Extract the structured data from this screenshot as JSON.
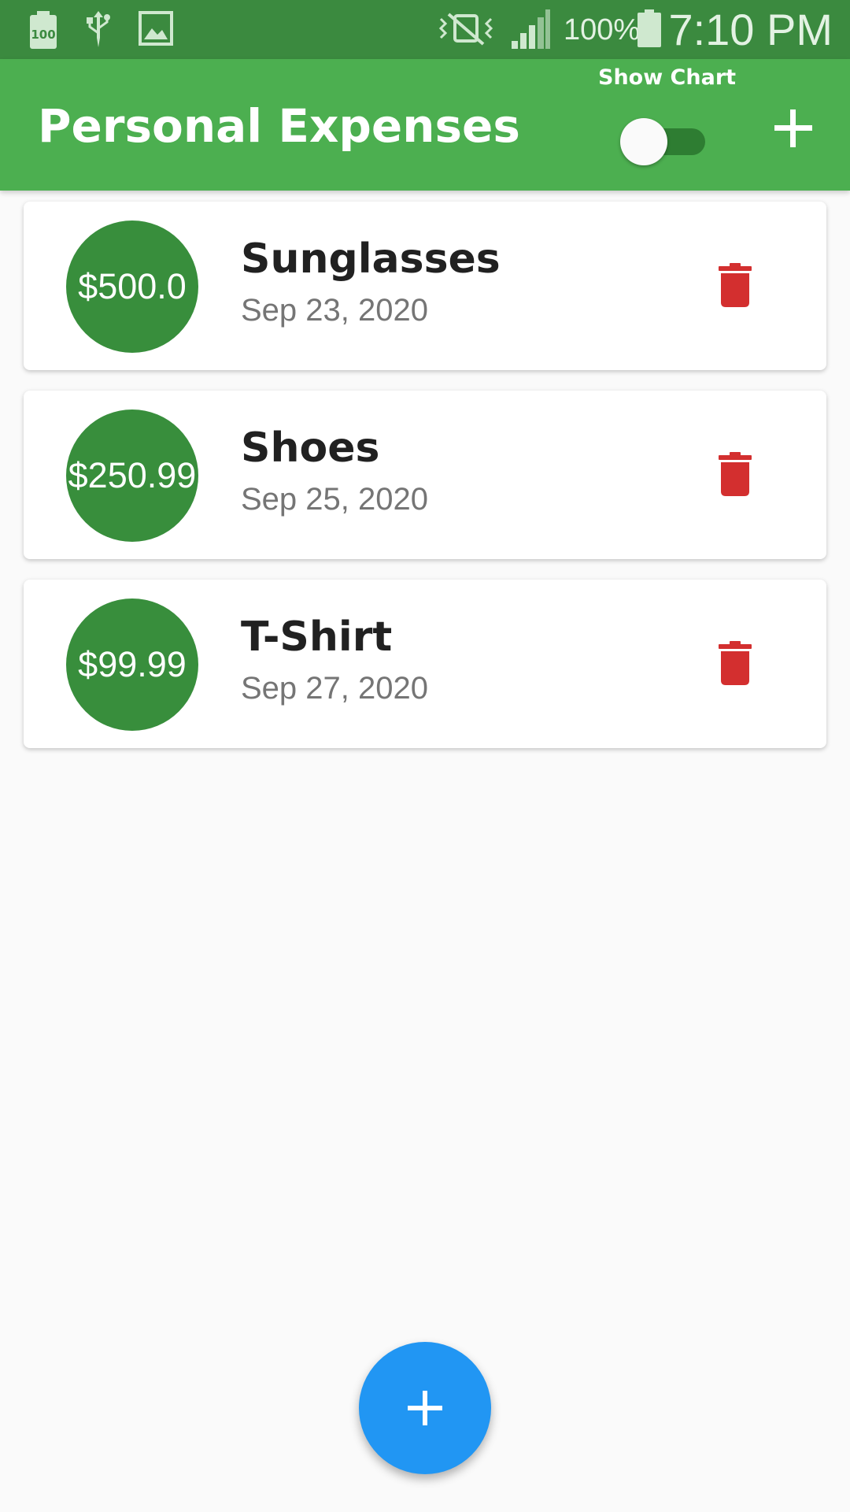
{
  "status_bar": {
    "battery_percent": "100%",
    "time": "7:10 PM",
    "icons": [
      "battery-saver-icon",
      "usb-icon",
      "image-icon",
      "vibrate-icon",
      "signal-icon",
      "battery-icon"
    ]
  },
  "app_bar": {
    "title": "Personal Expenses",
    "chart_toggle_label": "Show Chart",
    "chart_toggle_on": false,
    "add_icon": "plus-icon"
  },
  "transactions": [
    {
      "amount": "$500.0",
      "title": "Sunglasses",
      "date": "Sep 23, 2020"
    },
    {
      "amount": "$250.99",
      "title": "Shoes",
      "date": "Sep 25, 2020"
    },
    {
      "amount": "$99.99",
      "title": "T-Shirt",
      "date": "Sep 27, 2020"
    }
  ],
  "fab": {
    "icon": "plus-icon"
  },
  "colors": {
    "status_bar": "#3b8a3f",
    "app_bar": "#4caf50",
    "avatar": "#388e3c",
    "delete": "#d32f2f",
    "fab": "#2196f3",
    "background": "#fafafa"
  }
}
